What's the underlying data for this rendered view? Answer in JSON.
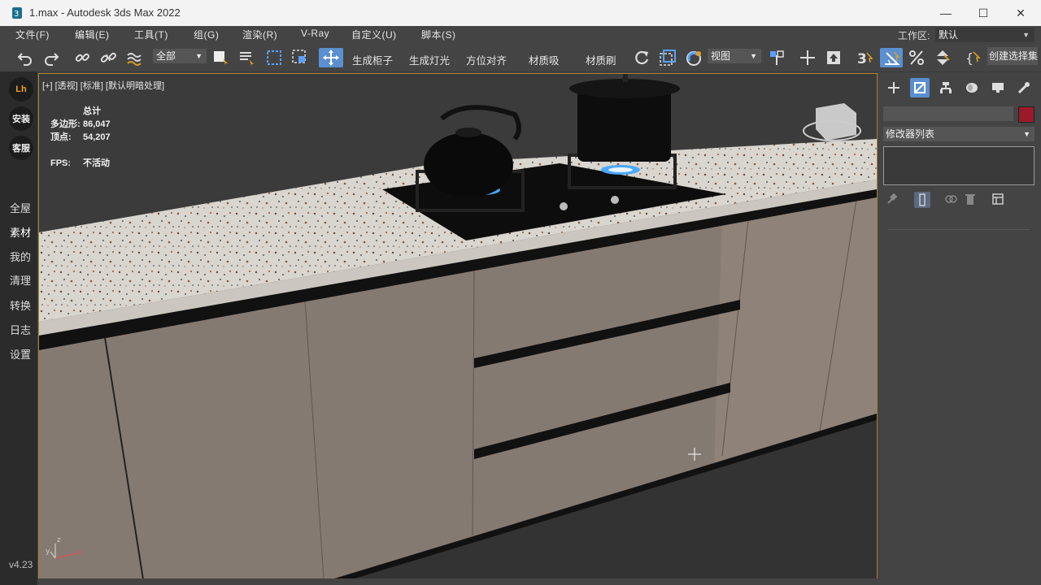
{
  "window": {
    "title": "1.max - Autodesk 3ds Max 2022",
    "minimize": "—",
    "maximize": "☐",
    "close": "✕"
  },
  "menu": {
    "items": [
      "文件(F)",
      "编辑(E)",
      "工具(T)",
      "组(G)",
      "渲染(R)",
      "V-Ray",
      "自定义(U)",
      "脚本(S)"
    ],
    "workspace_label": "工作区:",
    "workspace_value": "默认"
  },
  "toolbar": {
    "selection_filter": "全部",
    "text_buttons": [
      "生成柜子",
      "生成灯光",
      "方位对齐",
      "材质吸",
      "材质刷"
    ],
    "view_dropdown": "视图",
    "create_selection_set": "创建选择集"
  },
  "sidebar": {
    "top_buttons": [
      "Lh",
      "安装",
      "客服"
    ],
    "items": [
      "全屋",
      "素材",
      "我的",
      "清理",
      "转换",
      "日志",
      "设置"
    ],
    "version": "v4.23"
  },
  "viewport": {
    "label": "[+] [透视] [标准] [默认明暗处理]",
    "stats_header": "总计",
    "polys_label": "多边形:",
    "polys_value": "86,047",
    "verts_label": "顶点:",
    "verts_value": "54,207",
    "fps_label": "FPS:",
    "fps_value": "不活动"
  },
  "command_panel": {
    "modifier_list": "修改器列表",
    "object_color": "#9a1a2a"
  },
  "colors": {
    "accent_blue": "#5a8fd0",
    "viewport_border": "#a8832c",
    "ui_gray": "#444444"
  }
}
